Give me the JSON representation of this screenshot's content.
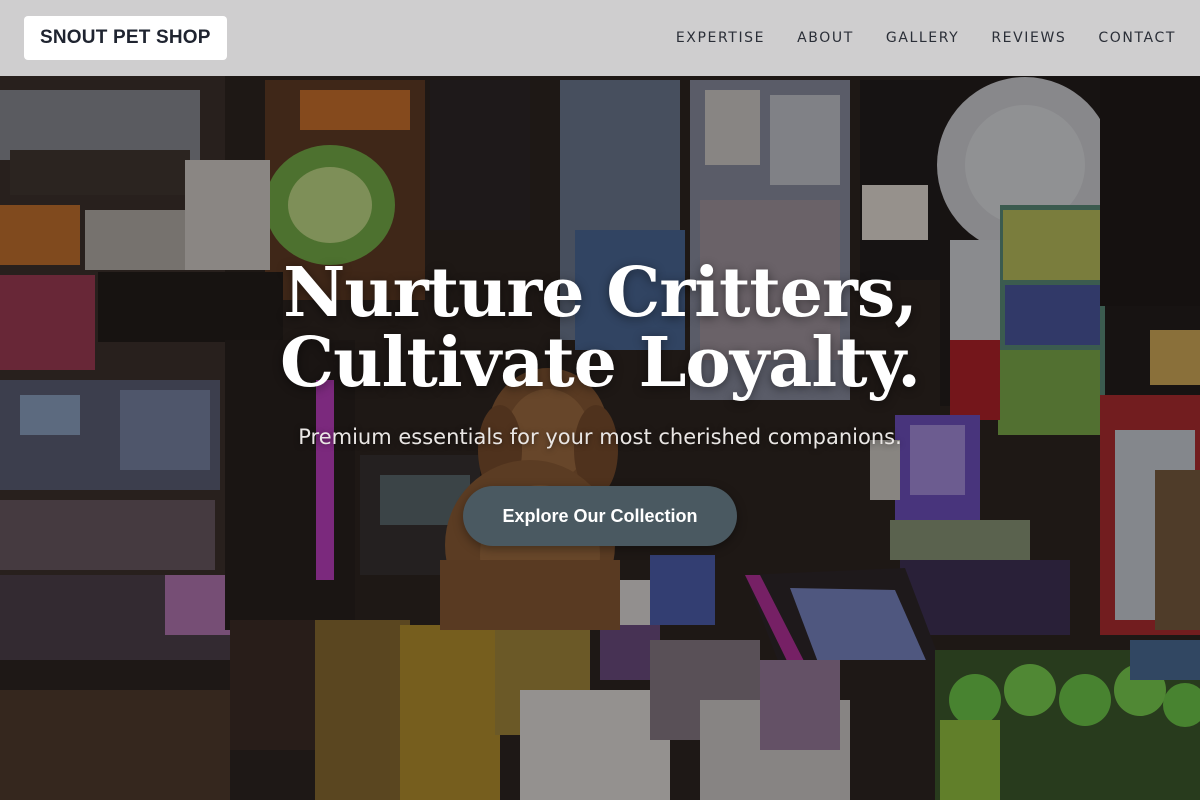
{
  "brand": {
    "name": "SNOUT PET SHOP"
  },
  "nav": {
    "items": [
      {
        "label": "EXPERTISE"
      },
      {
        "label": "ABOUT"
      },
      {
        "label": "GALLERY"
      },
      {
        "label": "REVIEWS"
      },
      {
        "label": "CONTACT"
      }
    ]
  },
  "hero": {
    "headline_line1": "Nurture Critters,",
    "headline_line2": "Cultivate Loyalty.",
    "subtitle": "Premium essentials for your most cherished companions.",
    "cta_label": "Explore Our Collection",
    "image": "shop-interior-with-dog-photo"
  },
  "colors": {
    "navbar_bg": "#ececee",
    "cta_bg": "#4a5961",
    "headline": "#ffffff"
  }
}
